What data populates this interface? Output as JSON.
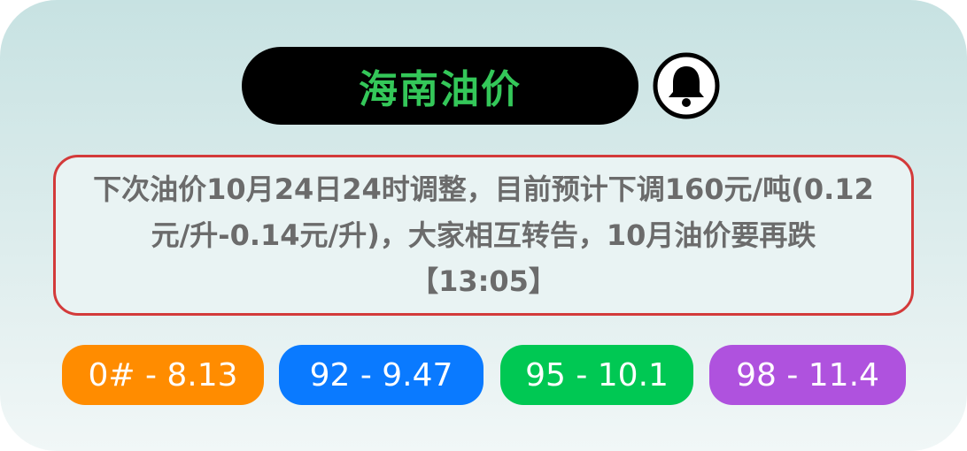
{
  "widget": {
    "title": "海南油价",
    "bell_icon": "bell-icon",
    "notice": "下次油价10月24日24时调整，目前预计下调160元/吨(0.12元/升-0.14元/升)，大家相互转告，10月油价要再跌【13:05】",
    "colors": {
      "title": "#34c759",
      "notice_border": "#d33a3a",
      "notice_text": "#6b6b6b"
    },
    "prices": [
      {
        "label": "0# - 8.13",
        "color": "#ff8c00"
      },
      {
        "label": "92 - 9.47",
        "color": "#0a7aff"
      },
      {
        "label": "95 - 10.1",
        "color": "#00c853"
      },
      {
        "label": "98 - 11.4",
        "color": "#af52de"
      }
    ]
  }
}
